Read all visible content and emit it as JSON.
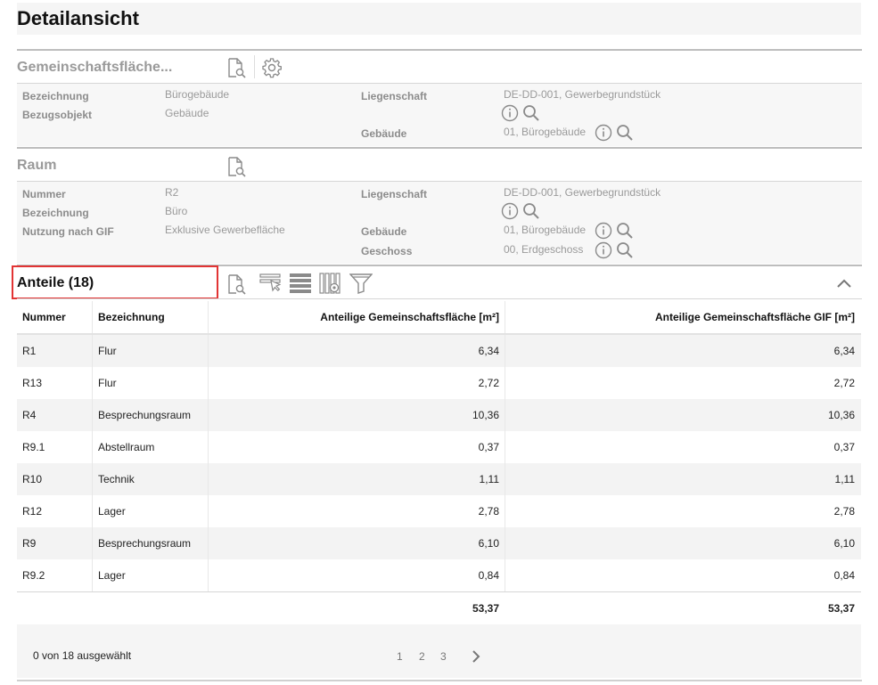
{
  "page": {
    "title": "Detailansicht"
  },
  "gemeinschaftsflaeche": {
    "title": "Gemeinschaftsfläche...",
    "fields_left": [
      {
        "label": "Bezeichnung",
        "value": "Bürogebäude"
      },
      {
        "label": "Bezugsobjekt",
        "value": "Gebäude"
      }
    ],
    "liegenschaft_label": "Liegenschaft",
    "liegenschaft_value": "DE-DD-001, Gewerbegrundstück",
    "gebaeude_label": "Gebäude",
    "gebaeude_value": "01, Bürogebäude"
  },
  "raum": {
    "title": "Raum",
    "fields_left": [
      {
        "label": "Nummer",
        "value": "R2"
      },
      {
        "label": "Bezeichnung",
        "value": "Büro"
      },
      {
        "label": "Nutzung nach GIF",
        "value": "Exklusive Gewerbefläche"
      }
    ],
    "liegenschaft_label": "Liegenschaft",
    "liegenschaft_value": "DE-DD-001, Gewerbegrundstück",
    "gebaeude_label": "Gebäude",
    "gebaeude_value": "01, Bürogebäude",
    "geschoss_label": "Geschoss",
    "geschoss_value": "00, Erdgeschoss"
  },
  "anteile": {
    "title": "Anteile (18)",
    "columns": [
      "Nummer",
      "Bezeichnung",
      "Anteilige Gemeinschaftsfläche [m²]",
      "Anteilige Gemeinschaftsfläche GIF [m²]"
    ],
    "rows": [
      [
        "R1",
        "Flur",
        "6,34",
        "6,34"
      ],
      [
        "R13",
        "Flur",
        "2,72",
        "2,72"
      ],
      [
        "R4",
        "Besprechungsraum",
        "10,36",
        "10,36"
      ],
      [
        "R9.1",
        "Abstellraum",
        "0,37",
        "0,37"
      ],
      [
        "R10",
        "Technik",
        "1,11",
        "1,11"
      ],
      [
        "R12",
        "Lager",
        "2,78",
        "2,78"
      ],
      [
        "R9",
        "Besprechungsraum",
        "6,10",
        "6,10"
      ],
      [
        "R9.2",
        "Lager",
        "0,84",
        "0,84"
      ]
    ],
    "sum_anteil": "53,37",
    "sum_gif": "53,37"
  },
  "footer": {
    "selected_text": "0 von 18 ausgewählt",
    "pages": [
      "1",
      "2",
      "3"
    ]
  },
  "icons": {
    "document_search": "document-search-icon",
    "settings": "gear-icon",
    "info": "info-icon",
    "search": "search-icon",
    "select_rows": "select-rows-icon",
    "list_view": "list-view-icon",
    "column_settings": "column-settings-icon",
    "filter": "filter-icon",
    "collapse": "chevron-up-icon",
    "next_page": "chevron-right-icon"
  },
  "colors": {
    "highlight": "#e23434",
    "muted_text": "#9a9a9a"
  }
}
